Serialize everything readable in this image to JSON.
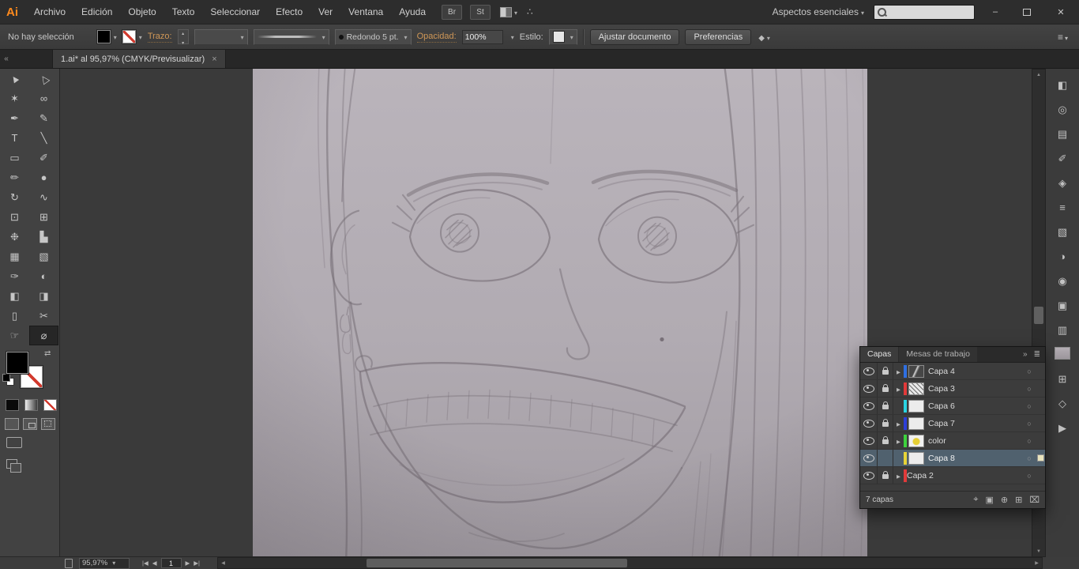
{
  "menubar": {
    "logo": "Ai",
    "menus": [
      {
        "name": "menu-archivo",
        "label": "Archivo"
      },
      {
        "name": "menu-edicion",
        "label": "Edición"
      },
      {
        "name": "menu-objeto",
        "label": "Objeto"
      },
      {
        "name": "menu-texto",
        "label": "Texto"
      },
      {
        "name": "menu-seleccionar",
        "label": "Seleccionar"
      },
      {
        "name": "menu-efecto",
        "label": "Efecto"
      },
      {
        "name": "menu-ver",
        "label": "Ver"
      },
      {
        "name": "menu-ventana",
        "label": "Ventana"
      },
      {
        "name": "menu-ayuda",
        "label": "Ayuda"
      }
    ],
    "bridge": "Br",
    "stock": "St",
    "workspace": "Aspectos esenciales",
    "window_controls": {
      "minimize": "–",
      "close": "✕"
    }
  },
  "control_bar": {
    "selection_status": "No hay selección",
    "stroke_label": "Trazo:",
    "brush_value": "Redondo 5 pt.",
    "opacity_label": "Opacidad:",
    "opacity_value": "100%",
    "style_label": "Estilo:",
    "fit_document_label": "Ajustar documento",
    "preferences_label": "Preferencias"
  },
  "tab_bar": {
    "collapse_icon": "«",
    "title": "1.ai* al 95,97% (CMYK/Previsualizar)",
    "close": "×"
  },
  "toolbar": {
    "tools": [
      {
        "name": "selection-tool",
        "glyph": "▲",
        "cls": "rot-a"
      },
      {
        "name": "direct-selection-tool",
        "glyph": "△",
        "cls": "rot-a"
      },
      {
        "name": "magic-wand-tool",
        "glyph": "✶"
      },
      {
        "name": "lasso-tool",
        "glyph": "∞"
      },
      {
        "name": "pen-tool",
        "glyph": "✒"
      },
      {
        "name": "anchor-point-tool",
        "glyph": "✎"
      },
      {
        "name": "type-tool",
        "glyph": "T"
      },
      {
        "name": "line-segment-tool",
        "glyph": "╲"
      },
      {
        "name": "rectangle-tool",
        "glyph": "▭"
      },
      {
        "name": "paintbrush-tool",
        "glyph": "✐"
      },
      {
        "name": "pencil-tool",
        "glyph": "✏"
      },
      {
        "name": "blob-brush-tool",
        "glyph": "●"
      },
      {
        "name": "rotate-tool",
        "glyph": "↻"
      },
      {
        "name": "width-tool",
        "glyph": "∿"
      },
      {
        "name": "free-transform-tool",
        "glyph": "⊡"
      },
      {
        "name": "perspective-grid-tool",
        "glyph": "⊞"
      },
      {
        "name": "symbol-sprayer-tool",
        "glyph": "❉"
      },
      {
        "name": "column-graph-tool",
        "glyph": "▙"
      },
      {
        "name": "mesh-tool",
        "glyph": "▦"
      },
      {
        "name": "gradient-tool",
        "glyph": "▧"
      },
      {
        "name": "eyedropper-tool",
        "glyph": "✑"
      },
      {
        "name": "blend-tool",
        "glyph": "◐"
      },
      {
        "name": "live-paint-bucket-tool",
        "glyph": "◧"
      },
      {
        "name": "live-paint-selection-tool",
        "glyph": "◨"
      },
      {
        "name": "artboard-tool",
        "glyph": "▯"
      },
      {
        "name": "slice-tool",
        "glyph": "✂"
      },
      {
        "name": "hand-tool",
        "glyph": "☞"
      },
      {
        "name": "zoom-tool",
        "glyph": "⌀",
        "active": true
      }
    ]
  },
  "dock": {
    "icons": [
      {
        "name": "color-panel-icon",
        "glyph": "◧"
      },
      {
        "name": "color-guide-panel-icon",
        "glyph": "◎"
      },
      {
        "name": "swatches-panel-icon",
        "glyph": "▤"
      },
      {
        "name": "brushes-panel-icon",
        "glyph": "✐"
      },
      {
        "name": "symbols-panel-icon",
        "glyph": "◈"
      },
      {
        "name": "stroke-panel-icon",
        "glyph": "≡"
      },
      {
        "name": "gradient-panel-icon",
        "glyph": "▧"
      },
      {
        "name": "transparency-panel-icon",
        "glyph": "◑"
      },
      {
        "name": "appearance-panel-icon",
        "glyph": "◉"
      },
      {
        "name": "graphic-styles-panel-icon",
        "glyph": "▣"
      },
      {
        "name": "layers-panel-icon",
        "glyph": "▥"
      },
      {
        "name": "artboards-panel-icon",
        "glyph": "▯"
      },
      {
        "name": "navigator-panel-icon",
        "glyph": "⊞"
      },
      {
        "name": "info-panel-icon",
        "glyph": "◇"
      },
      {
        "name": "actions-panel-icon",
        "glyph": "▶"
      }
    ]
  },
  "layers_panel": {
    "tab_active": "Capas",
    "tab_inactive": "Mesas de trabajo",
    "collapse_icon": "»",
    "rows": [
      {
        "id": "layer-row-capa-4",
        "name": "Capa 4",
        "color": "#2e6fe2",
        "locked": true,
        "expand": true,
        "thumb": "dark",
        "selected": false
      },
      {
        "id": "layer-row-capa-3",
        "name": "Capa 3",
        "color": "#e23a3a",
        "locked": true,
        "expand": true,
        "thumb": "scribble",
        "selected": false
      },
      {
        "id": "layer-row-capa-6",
        "name": "Capa 6",
        "color": "#2ad4e2",
        "locked": true,
        "expand": false,
        "thumb": "white",
        "selected": false
      },
      {
        "id": "layer-row-capa-7",
        "name": "Capa 7",
        "color": "#2d3fd9",
        "locked": true,
        "expand": true,
        "thumb": "white",
        "selected": false
      },
      {
        "id": "layer-row-color",
        "name": "color",
        "color": "#3dd23d",
        "locked": true,
        "expand": true,
        "thumb": "splash",
        "selected": false
      },
      {
        "id": "layer-row-capa-8",
        "name": "Capa 8",
        "color": "#e8d437",
        "locked": false,
        "expand": false,
        "thumb": "white",
        "selected": true
      },
      {
        "id": "layer-row-capa-2",
        "name": "Capa 2",
        "color": "#e23a3a",
        "locked": true,
        "expand": true,
        "thumb": "photo",
        "selected": false
      }
    ],
    "footer_count": "7 capas",
    "footer_buttons": [
      {
        "name": "locate-object-button",
        "glyph": "⌖"
      },
      {
        "name": "make-clipping-mask-button",
        "glyph": "▣"
      },
      {
        "name": "new-sublayer-button",
        "glyph": "⊕"
      },
      {
        "name": "new-layer-button",
        "glyph": "⊞"
      },
      {
        "name": "delete-layer-button",
        "glyph": "⌧"
      }
    ]
  },
  "status_bar": {
    "zoom": "95,97%",
    "nav_first": "|◀",
    "nav_prev": "◀",
    "artboard": "1",
    "nav_next": "▶",
    "nav_last": "▶|"
  }
}
